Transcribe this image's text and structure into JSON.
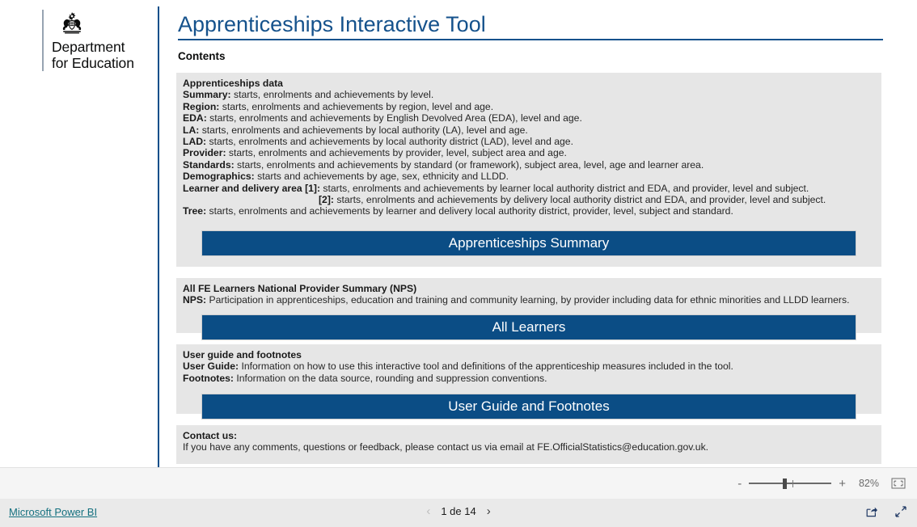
{
  "brand": {
    "crest_icon": "royal-crest-icon",
    "line1": "Department",
    "line2": "for Education"
  },
  "header": {
    "title": "Apprenticeships Interactive Tool",
    "contents_label": "Contents"
  },
  "panels": {
    "apprenticeships": {
      "heading": "Apprenticeships data",
      "lines": [
        {
          "label": "Summary:",
          "text": " starts, enrolments and achievements by level."
        },
        {
          "label": "Region:",
          "text": " starts, enrolments and achievements by region, level and age."
        },
        {
          "label": "EDA:",
          "text": " starts, enrolments and achievements by English Devolved Area (EDA), level and age."
        },
        {
          "label": "LA:",
          "text": " starts, enrolments and achievements by local authority (LA), level and age."
        },
        {
          "label": "LAD:",
          "text": " starts, enrolments and achievements by local authority district (LAD), level and age."
        },
        {
          "label": "Provider:",
          "text": " starts, enrolments and achievements by provider, level, subject area and age."
        },
        {
          "label": "Standards:",
          "text": " starts, enrolments and achievements by standard (or framework), subject area, level, age and learner area."
        },
        {
          "label": "Demographics:",
          "text": " starts and achievements by age, sex, ethnicity and LLDD."
        },
        {
          "label": "Learner and delivery area [1]:",
          "text": " starts, enrolments and achievements by learner local authority district and EDA, and provider, level and subject."
        }
      ],
      "indent_line": {
        "label": "[2]:",
        "text": " starts, enrolments and achievements by delivery local authority district and EDA, and provider, level and subject."
      },
      "last_line": {
        "label": "Tree:",
        "text": " starts, enrolments and achievements by learner and delivery local authority district, provider, level, subject and standard."
      },
      "cta_label": "Apprenticeships Summary"
    },
    "all_fe": {
      "heading": "All FE Learners National Provider Summary (NPS)",
      "lines": [
        {
          "label": "NPS:",
          "text": " Participation in apprenticeships, education and training and community learning, by provider including data for ethnic minorities and LLDD learners."
        }
      ],
      "cta_label": "All Learners"
    },
    "guide": {
      "heading": "User guide and footnotes",
      "lines": [
        {
          "label": "User Guide:",
          "text": " Information on how to use this interactive tool and definitions of the apprenticeship measures included in the tool."
        },
        {
          "label": "Footnotes:",
          "text": " Information on the data source, rounding and suppression conventions."
        }
      ],
      "cta_label": "User Guide and Footnotes"
    },
    "contact": {
      "heading": "Contact us:",
      "lines": [
        {
          "label": "",
          "text": "If you have any comments, questions or feedback, please contact us via email at FE.OfficialStatistics@education.gov.uk."
        }
      ]
    }
  },
  "zoombar": {
    "minus_label": "-",
    "plus_label": "+",
    "zoom_level": "82%",
    "fit_icon": "fit-to-page-icon"
  },
  "statusbar": {
    "powerbi_label": "Microsoft Power BI",
    "prev_icon": "chevron-left-icon",
    "next_icon": "chevron-right-icon",
    "page_indicator": "1 de 14",
    "share_icon": "share-icon",
    "fullscreen_icon": "fullscreen-icon"
  },
  "colors": {
    "brand_blue": "#15528c",
    "cta_blue": "#0b4d85",
    "panel_grey": "#e6e6e6",
    "link_teal": "#14707f"
  }
}
